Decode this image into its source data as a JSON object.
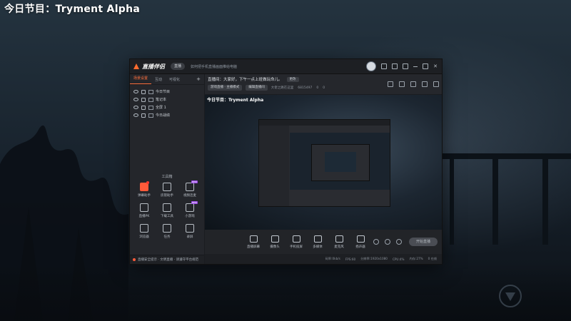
{
  "overlay": {
    "title": "今日节目：Tryment Alpha"
  },
  "app": {
    "name": "直播伴侣",
    "live_pill": "直播",
    "title_link": "如何把手机直播画面推给电脑",
    "sidebar": {
      "tabs": [
        {
          "label": "场景设置",
          "active": true
        },
        {
          "label": "互动",
          "active": false
        },
        {
          "label": "可视化",
          "active": false
        }
      ],
      "add": "+",
      "sources": [
        {
          "label": "今日节目"
        },
        {
          "label": "笔记本"
        },
        {
          "label": "全屏 1"
        },
        {
          "label": "今日战绩"
        }
      ],
      "toolbox_title": "工具箱",
      "tools": [
        {
          "label": "弹幕助手",
          "hot": true,
          "badge": "",
          "dot": true
        },
        {
          "label": "房管助手",
          "hot": false,
          "badge": "",
          "dot": false
        },
        {
          "label": "视频连麦",
          "hot": false,
          "badge": "NEW",
          "dot": false
        },
        {
          "label": "直播PK",
          "hot": false,
          "badge": "",
          "dot": false
        },
        {
          "label": "下载工具",
          "hot": false,
          "badge": "",
          "dot": false
        },
        {
          "label": "小游戏",
          "hot": false,
          "badge": "NEW",
          "dot": false
        },
        {
          "label": "浏览器",
          "hot": false,
          "badge": "",
          "dot": false
        },
        {
          "label": "任务",
          "hot": false,
          "badge": "",
          "dot": false
        },
        {
          "label": "录屏",
          "hot": false,
          "badge": "",
          "dot": false
        }
      ],
      "notice": "直播安全提示 · 文明直播 · 请遵守平台规范"
    },
    "room": {
      "announcement": "直播间：大家好，下午一点上班做玩命儿。",
      "announcement_tag": "更改",
      "chips": [
        "游戏直播 · 主播模式",
        "编辑直播间"
      ],
      "stats": [
        "大佬之路在这里",
        "6815497",
        "0",
        "0"
      ]
    },
    "preview": {
      "title": "今日节目：Tryment Alpha"
    },
    "controls": [
      {
        "label": "直播屏幕",
        "icon": "monitor-icon"
      },
      {
        "label": "摄像头",
        "icon": "camera-icon"
      },
      {
        "label": "手机投屏",
        "icon": "phone-cast-icon"
      },
      {
        "label": "多媒体",
        "icon": "media-icon"
      },
      {
        "label": "麦克风",
        "icon": "mic-icon"
      },
      {
        "label": "扬声器",
        "icon": "speaker-icon"
      }
    ],
    "go_live": "开始直播",
    "status": [
      "码率:0kb/s",
      "FPS:60",
      "分辨率:1920x1080",
      "CPU:4%",
      "内存:27%",
      "0 在线"
    ]
  }
}
